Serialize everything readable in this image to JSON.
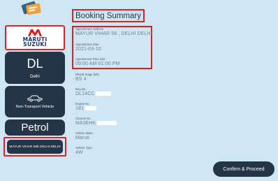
{
  "icons": {
    "ticket": "ticket-icon",
    "brand_logo": "maruti-suzuki-logo-icon",
    "car": "car-icon"
  },
  "left_panel": {
    "brand_text_line1": "MARUTI",
    "brand_text_line2": "SUZUKI",
    "state_code": "DL",
    "state_name": "Delhi",
    "vehicle_category": "Non-Transport Vehicle",
    "fuel_type": "Petrol",
    "dealer": "MAYUR VIHAR 58b DELHI DELHI"
  },
  "summary": {
    "title": "Booking Summary",
    "fields": [
      {
        "label": "Appointment Address",
        "value": "MAYUR VIHAR 58 , DELHI DELHI"
      },
      {
        "label": "Appointment Date",
        "value": "2021-03-10"
      },
      {
        "label": "Appointment Time Slot",
        "value": "09:00 AM-01:00 PM"
      },
      {
        "label": "Bharat Stage (BS)",
        "value": "BS 4"
      },
      {
        "label": "Reg No",
        "value": "DL14CC"
      },
      {
        "label": "Engine No",
        "value": "181"
      },
      {
        "label": "Chassis No",
        "value": "MA3EHK"
      },
      {
        "label": "Vehicle Make",
        "value": "Maruti"
      },
      {
        "label": "Vehicle Type",
        "value": "4W"
      }
    ]
  },
  "actions": {
    "confirm_label": "Confirm & Proceed"
  },
  "colors": {
    "background": "#cfe6f5",
    "tile": "#253548",
    "highlight": "#e02020"
  }
}
